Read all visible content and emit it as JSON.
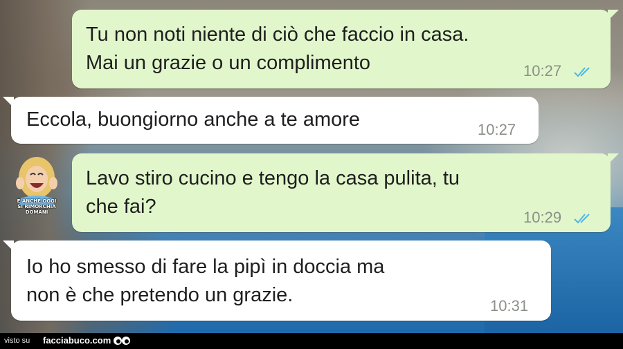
{
  "chat": {
    "messages": [
      {
        "direction": "outgoing",
        "text": "Tu non noti niente di ciò che faccio in casa.\nMai un grazie o un complimento",
        "time": "10:27",
        "status": "read"
      },
      {
        "direction": "incoming",
        "text": "Eccola, buongiorno anche a te amore",
        "time": "10:27"
      },
      {
        "direction": "outgoing",
        "text": "Lavo stiro cucino e tengo la casa pulita, tu\nche fai?",
        "time": "10:29",
        "status": "read"
      },
      {
        "direction": "incoming",
        "text": "Io ho smesso di fare la pipì in doccia ma\nnon è che pretendo un grazie.",
        "time": "10:31"
      }
    ],
    "sticker": {
      "caption": "E ANCHE OGGI\nSI RIMORCHIA DOMANI",
      "icon": "laughing-woman-sticker"
    },
    "colors": {
      "outgoing_bubble": "#e1f7cb",
      "incoming_bubble": "#ffffff",
      "read_ticks": "#4fb6ec"
    }
  },
  "footer": {
    "prefix": "visto su",
    "site": "facciabuco.com",
    "icon": "googly-eyes-icon"
  }
}
